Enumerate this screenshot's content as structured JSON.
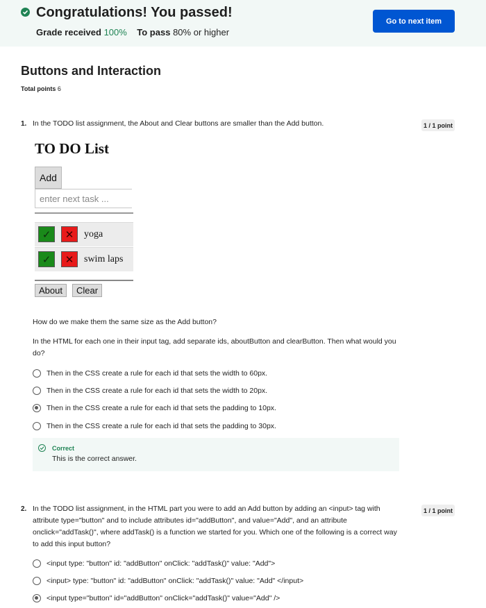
{
  "banner": {
    "title": "Congratulations! You passed!",
    "grade_label": "Grade received",
    "grade_value": "100%",
    "pass_label": "To pass",
    "pass_value": "80% or higher",
    "next_button": "Go to next item"
  },
  "quiz": {
    "title": "Buttons and Interaction",
    "total_points_label": "Total points",
    "total_points_value": "6"
  },
  "questions": [
    {
      "number": "1.",
      "text": "In the TODO list assignment, the About and Clear buttons are smaller than the Add button.",
      "points": "1 / 1 point",
      "image": {
        "title": "TO DO List",
        "add_label": "Add",
        "input_placeholder": "enter next task ...",
        "tasks": [
          "yoga",
          "swim laps"
        ],
        "about_label": "About",
        "clear_label": "Clear"
      },
      "prompt1": "How do we make them the same size as the Add button?",
      "prompt2": "In the HTML for each one in their input tag, add separate ids, aboutButton and clearButton. Then what would you do?",
      "options": [
        "Then in the CSS create a rule for each id that sets the width to 60px.",
        "Then in the CSS create a rule for each id that sets the width to 20px.",
        "Then in the CSS create a rule for each id that sets the  padding to 10px.",
        "Then in the CSS  create a rule for each id that sets the padding to 30px."
      ],
      "selected": 2,
      "feedback": {
        "title": "Correct",
        "text": "This is the correct answer."
      }
    },
    {
      "number": "2.",
      "text": "In the TODO list assignment, in the HTML part you were to add an Add button by adding an <input> tag with attribute type=\"button\" and to include attributes id=\"addButton\", and value=\"Add\", and an attribute onclick=\"addTask()\", where addTask() is a function we started for you. Which one of the following is a correct way to add this input button?",
      "points": "1 / 1 point",
      "options": [
        "<input type: \"button\" id: \"addButton\" onClick: \"addTask()\" value: \"Add\">",
        "<input>  type: \"button\" id: \"addButton\" onClick: \"addTask()\" value: \"Add\" </input>",
        "<input type=\"button\" id=\"addButton\" onClick=\"addTask()\" value=\"Add\" />"
      ],
      "selected": 2
    }
  ],
  "colors": {
    "accent": "#0056d2",
    "success": "#1f8354",
    "banner_bg": "#f2f8f6"
  }
}
